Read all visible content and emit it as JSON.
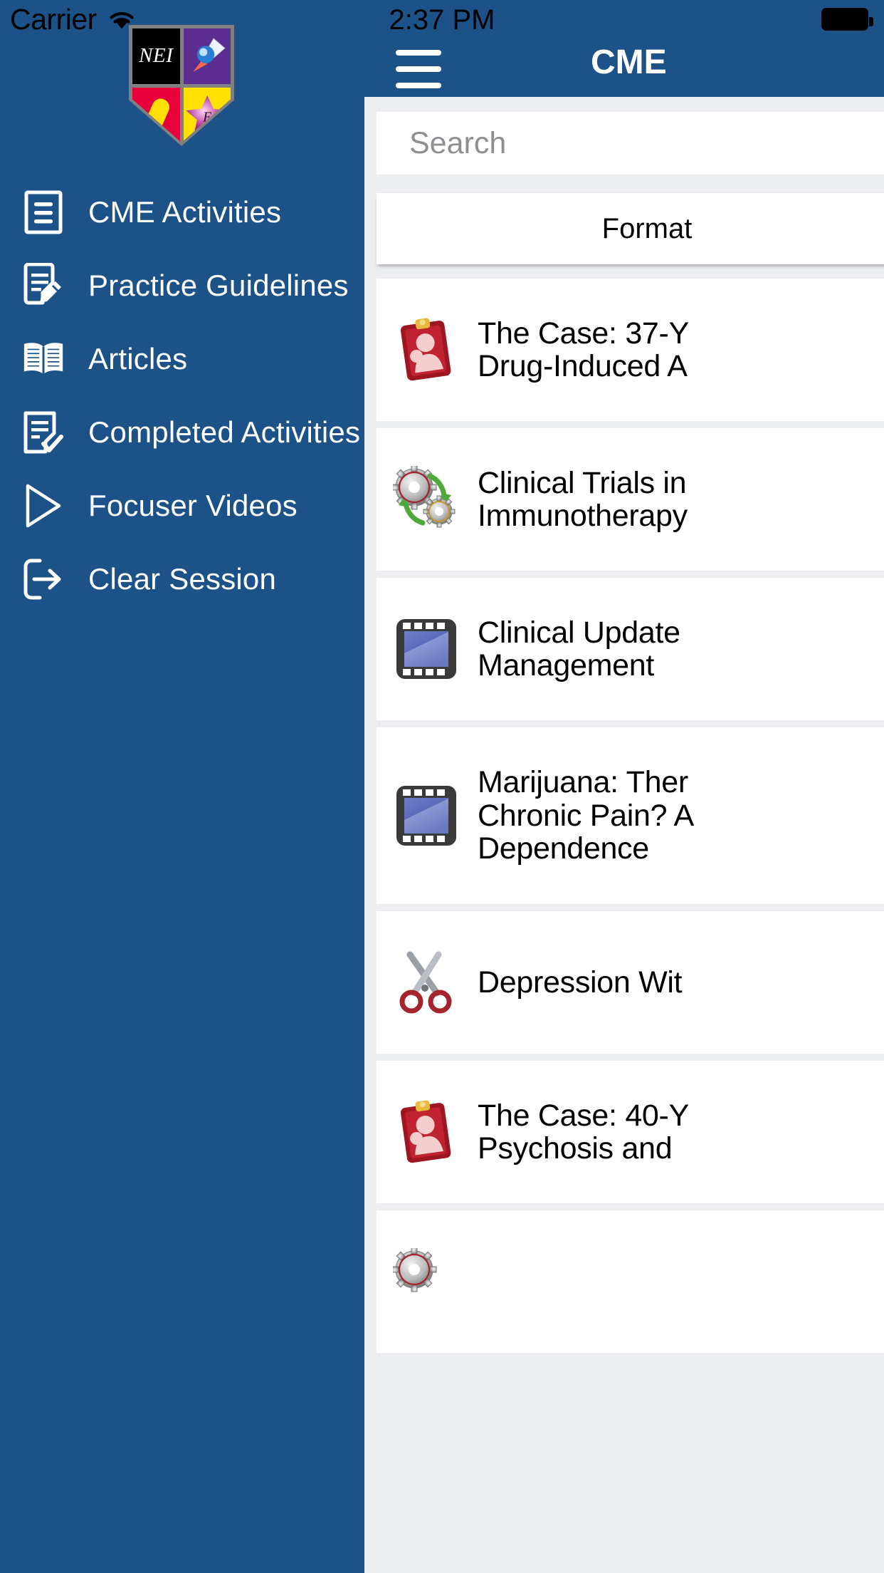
{
  "status_bar": {
    "carrier": "Carrier",
    "wifi_icon": "wifi-icon",
    "time": "2:37 PM",
    "battery_icon": "battery-full-icon"
  },
  "nav_bar": {
    "menu_icon": "hamburger-menu-icon",
    "title": "CME"
  },
  "drawer": {
    "logo": {
      "name": "nei-shield-logo",
      "quadrant_text": "NEI",
      "star_letter": "E",
      "colors": {
        "black": "#000000",
        "purple": "#5c2d91",
        "red": "#e8003c",
        "yellow": "#ffe000",
        "border": "#808080"
      }
    },
    "background_color": "#1c5288",
    "items": [
      {
        "label": "CME Activities",
        "icon": "document-lines-icon"
      },
      {
        "label": "Practice Guidelines",
        "icon": "document-pencil-icon"
      },
      {
        "label": "Articles",
        "icon": "open-book-icon"
      },
      {
        "label": "Completed Activities",
        "icon": "document-check-icon"
      },
      {
        "label": "Focuser Videos",
        "icon": "play-triangle-icon"
      },
      {
        "label": "Clear Session",
        "icon": "logout-arrow-icon"
      }
    ]
  },
  "content": {
    "search": {
      "placeholder": "Search",
      "value": ""
    },
    "segmented_control": {
      "selected": "Format"
    },
    "activities": [
      {
        "icon": "clipboard-patient-icon",
        "title": "The Case: 37-Y\nDrug-Induced A"
      },
      {
        "icon": "gears-icon",
        "title": "Clinical Trials in\nImmunotherapy"
      },
      {
        "icon": "film-strip-icon",
        "title": "Clinical Update\nManagement"
      },
      {
        "icon": "film-strip-icon",
        "title": "Marijuana: Ther\nChronic Pain? A\nDependence"
      },
      {
        "icon": "scissors-icon",
        "title": "Depression Wit"
      },
      {
        "icon": "clipboard-patient-icon",
        "title": "The Case: 40-Y\nPsychosis and "
      },
      {
        "icon": "gears-icon",
        "title": ""
      }
    ]
  }
}
